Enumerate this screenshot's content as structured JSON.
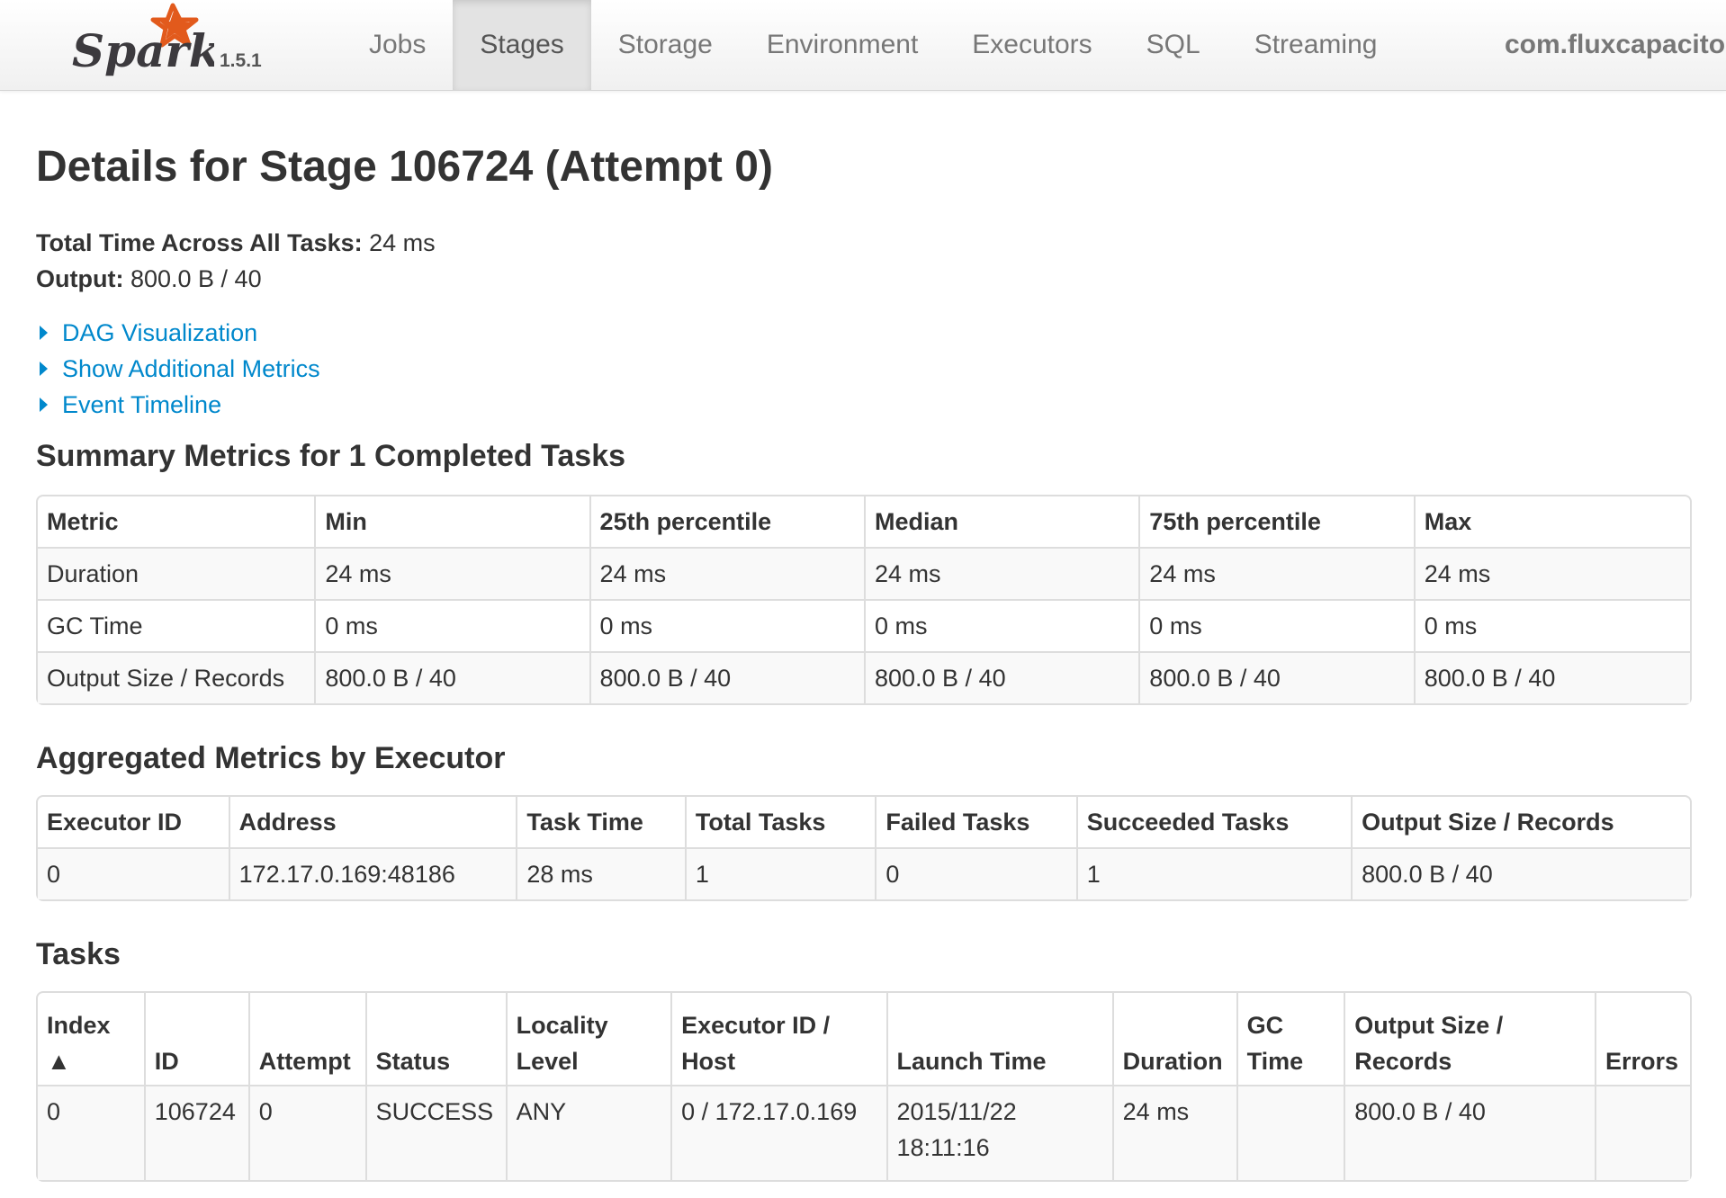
{
  "navbar": {
    "brand": "Spark",
    "version": "1.5.1",
    "tabs": [
      {
        "label": "Jobs",
        "active": false
      },
      {
        "label": "Stages",
        "active": true
      },
      {
        "label": "Storage",
        "active": false
      },
      {
        "label": "Environment",
        "active": false
      },
      {
        "label": "Executors",
        "active": false
      },
      {
        "label": "SQL",
        "active": false
      },
      {
        "label": "Streaming",
        "active": false
      }
    ],
    "app_name": "com.fluxcapacito",
    "colors": {
      "logo_orange": "#E25A1C",
      "logo_text": "#3C3A3E"
    }
  },
  "page": {
    "title": "Details for Stage 106724 (Attempt 0)",
    "total_time_label": "Total Time Across All Tasks:",
    "total_time_value": "24 ms",
    "output_label": "Output:",
    "output_value": "800.0 B / 40",
    "links": [
      "DAG Visualization",
      "Show Additional Metrics",
      "Event Timeline"
    ],
    "link_color": "#0088cc"
  },
  "summary_metrics": {
    "heading": "Summary Metrics for 1 Completed Tasks",
    "columns": [
      "Metric",
      "Min",
      "25th percentile",
      "Median",
      "75th percentile",
      "Max"
    ],
    "rows": [
      [
        "Duration",
        "24 ms",
        "24 ms",
        "24 ms",
        "24 ms",
        "24 ms"
      ],
      [
        "GC Time",
        "0 ms",
        "0 ms",
        "0 ms",
        "0 ms",
        "0 ms"
      ],
      [
        "Output Size / Records",
        "800.0 B / 40",
        "800.0 B / 40",
        "800.0 B / 40",
        "800.0 B / 40",
        "800.0 B / 40"
      ]
    ]
  },
  "executor_metrics": {
    "heading": "Aggregated Metrics by Executor",
    "columns": [
      "Executor ID",
      "Address",
      "Task Time",
      "Total Tasks",
      "Failed Tasks",
      "Succeeded Tasks",
      "Output Size / Records"
    ],
    "rows": [
      [
        "0",
        "172.17.0.169:48186",
        "28 ms",
        "1",
        "0",
        "1",
        "800.0 B / 40"
      ]
    ]
  },
  "tasks": {
    "heading": "Tasks",
    "columns": [
      {
        "line1": "Index",
        "line2": "▲"
      },
      {
        "line1": "",
        "line2": "ID"
      },
      {
        "line1": "",
        "line2": "Attempt"
      },
      {
        "line1": "",
        "line2": "Status"
      },
      {
        "line1": "Locality",
        "line2": "Level"
      },
      {
        "line1": "Executor ID /",
        "line2": "Host"
      },
      {
        "line1": "",
        "line2": "Launch Time"
      },
      {
        "line1": "",
        "line2": "Duration"
      },
      {
        "line1": "GC",
        "line2": "Time"
      },
      {
        "line1": "Output Size /",
        "line2": "Records"
      },
      {
        "line1": "",
        "line2": "Errors"
      }
    ],
    "rows": [
      {
        "cells": [
          "0",
          "106724",
          "0",
          "SUCCESS",
          "ANY",
          "0 / 172.17.0.169"
        ],
        "launch_time_line1": "2015/11/22",
        "launch_time_line2": "18:11:16",
        "duration": "24 ms",
        "gc_time": "",
        "output": "800.0 B / 40",
        "errors": ""
      }
    ]
  }
}
